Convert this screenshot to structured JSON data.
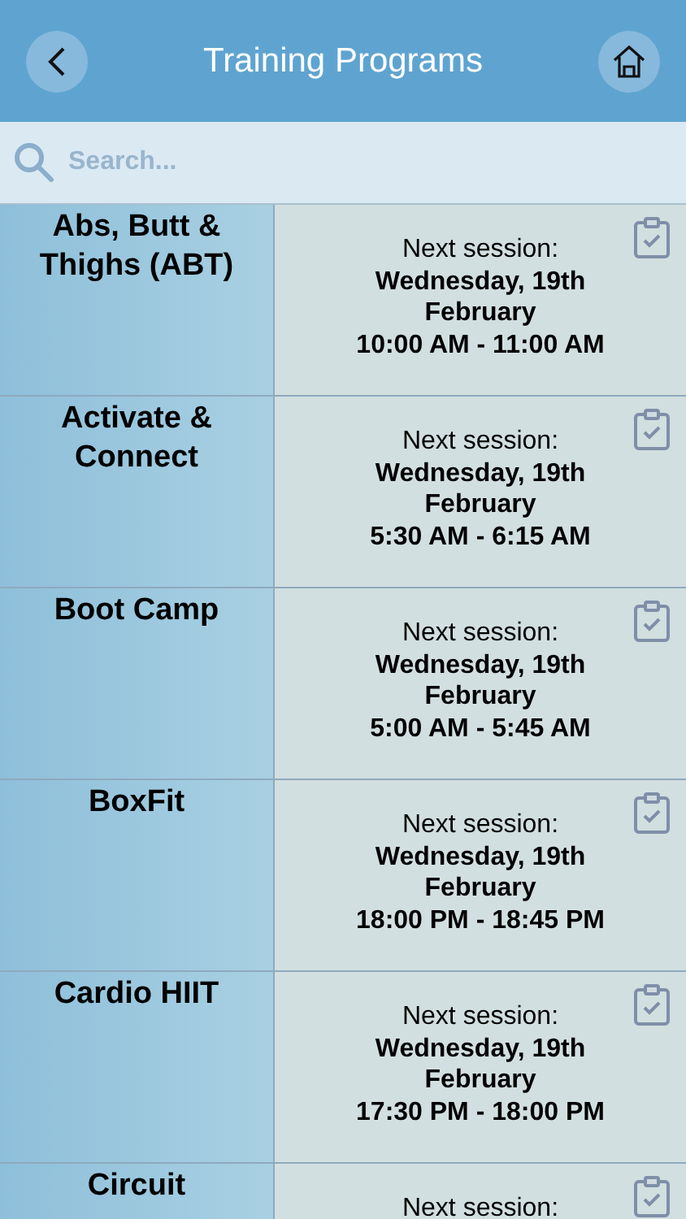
{
  "header": {
    "title": "Training Programs"
  },
  "search": {
    "placeholder": "Search..."
  },
  "programs": [
    {
      "name": "Abs, Butt & Thighs (ABT)",
      "label": "Next session:",
      "lines": [
        "Wednesday, 19th",
        "February",
        "10:00 AM - 11:00 AM"
      ]
    },
    {
      "name": "Activate & Connect",
      "label": "Next session:",
      "lines": [
        "Wednesday, 19th",
        "February",
        "5:30 AM - 6:15 AM"
      ]
    },
    {
      "name": "Boot Camp",
      "label": "Next session:",
      "lines": [
        "Wednesday, 19th",
        "February",
        "5:00 AM - 5:45 AM"
      ]
    },
    {
      "name": "BoxFit",
      "label": "Next session:",
      "lines": [
        "Wednesday, 19th",
        "February",
        "18:00 PM - 18:45 PM"
      ]
    },
    {
      "name": "Cardio HIIT",
      "label": "Next session:",
      "lines": [
        "Wednesday, 19th",
        "February",
        "17:30 PM - 18:00 PM"
      ]
    },
    {
      "name": "Circuit",
      "label": "Next session:"
    }
  ]
}
